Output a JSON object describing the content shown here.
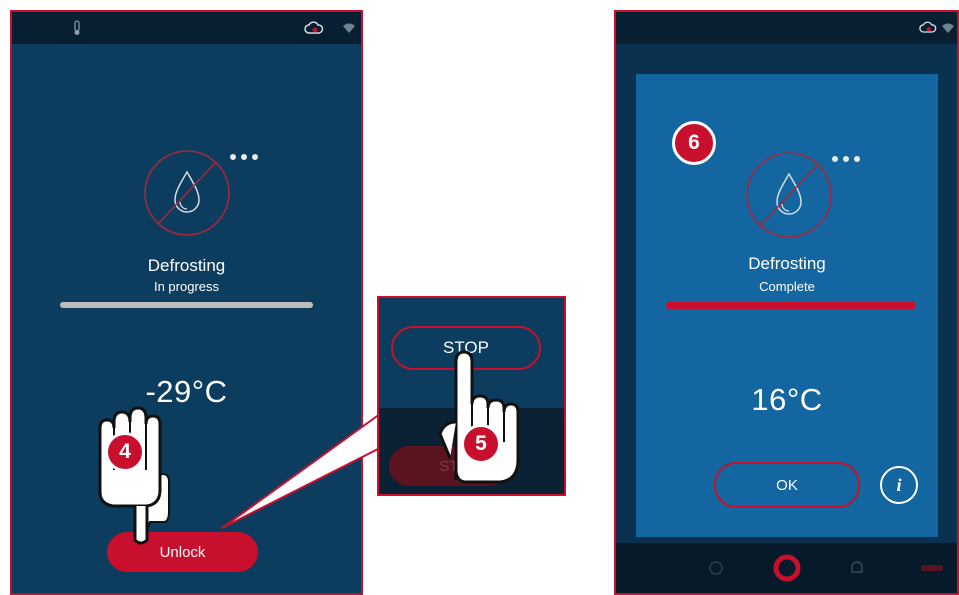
{
  "left_screen": {
    "status_text": "",
    "title": "Defrosting",
    "subtitle": "In progress",
    "progress": 1.0,
    "temperature": "-29°C",
    "unlock_label": "Unlock",
    "step_badge": "4"
  },
  "zoom_panel": {
    "stop_label": "STOP",
    "hidden_button_label": "ST",
    "step_badge": "5"
  },
  "right_screen": {
    "title": "Defrosting",
    "subtitle": "Complete",
    "progress": 1.0,
    "temperature": "16°C",
    "ok_label": "OK",
    "info_label": "i",
    "step_badge": "6"
  },
  "colors": {
    "accent": "#c8102e",
    "panel": "#0c3d5e",
    "progress_grey": "#bdbdbd"
  },
  "icons": [
    "defrost-drop-icon",
    "more-dots-icon",
    "hand-pointer-icon",
    "info-icon",
    "wifi-icon",
    "cloud-icon"
  ]
}
